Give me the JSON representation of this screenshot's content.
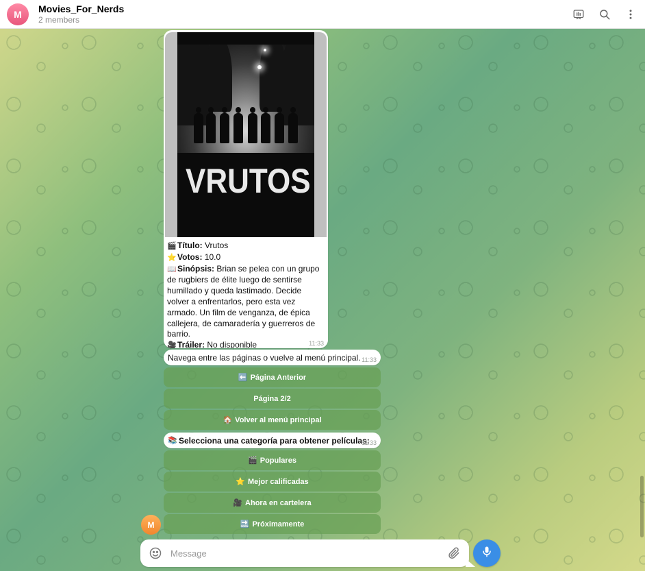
{
  "header": {
    "avatar_letter": "M",
    "title": "Movies_For_Nerds",
    "subtitle": "2 members",
    "actions": [
      "video-chat-icon",
      "search-icon",
      "more-vertical-icon"
    ]
  },
  "movie_message": {
    "poster_text": "VRUTOS",
    "title_label": "Título:",
    "title_value": "Vrutos",
    "votes_label": "Votos:",
    "votes_value": "10.0",
    "synopsis_label": "Sinópsis:",
    "synopsis_value": "Brian se pelea con un grupo de rugbiers de élite luego de sentirse humillado y queda lastimado. Decide volver a enfrentarlos, pero esta vez armado. Un film de venganza, de épica callejera, de camaradería y guerreros de barrio.",
    "trailer_label": "Tráiler:",
    "trailer_value": "No disponible",
    "time": "11:33",
    "emoji": {
      "title": "🎬",
      "votes": "⭐",
      "synopsis": "📖",
      "trailer": "🎥"
    }
  },
  "nav_message": {
    "text": "Navega entre las páginas o vuelve al menú principal.",
    "time": "11:33",
    "buttons": [
      {
        "emoji": "⬅️",
        "label": "Página Anterior"
      },
      {
        "emoji": "",
        "label": "Página 2/2"
      },
      {
        "emoji": "🏠",
        "label": "Volver al menú principal"
      }
    ]
  },
  "category_message": {
    "emoji": "📚",
    "text": "Selecciona una categoría para obtener películas:",
    "time": "11:33",
    "buttons": [
      {
        "emoji": "🎬",
        "label": "Populares"
      },
      {
        "emoji": "⭐",
        "label": "Mejor calificadas"
      },
      {
        "emoji": "🎥",
        "label": "Ahora en cartelera"
      },
      {
        "emoji": "🔜",
        "label": "Próximamente"
      }
    ]
  },
  "sender_avatar_letter": "M",
  "composer": {
    "placeholder": "Message",
    "icons": [
      "emoji-icon",
      "attach-icon",
      "microphone-icon"
    ]
  },
  "colors": {
    "accent": "#3a8ee6",
    "keyboard_button": "#68a054",
    "chat_avatar": "#e8567c",
    "sender_avatar": "#f0872e"
  }
}
